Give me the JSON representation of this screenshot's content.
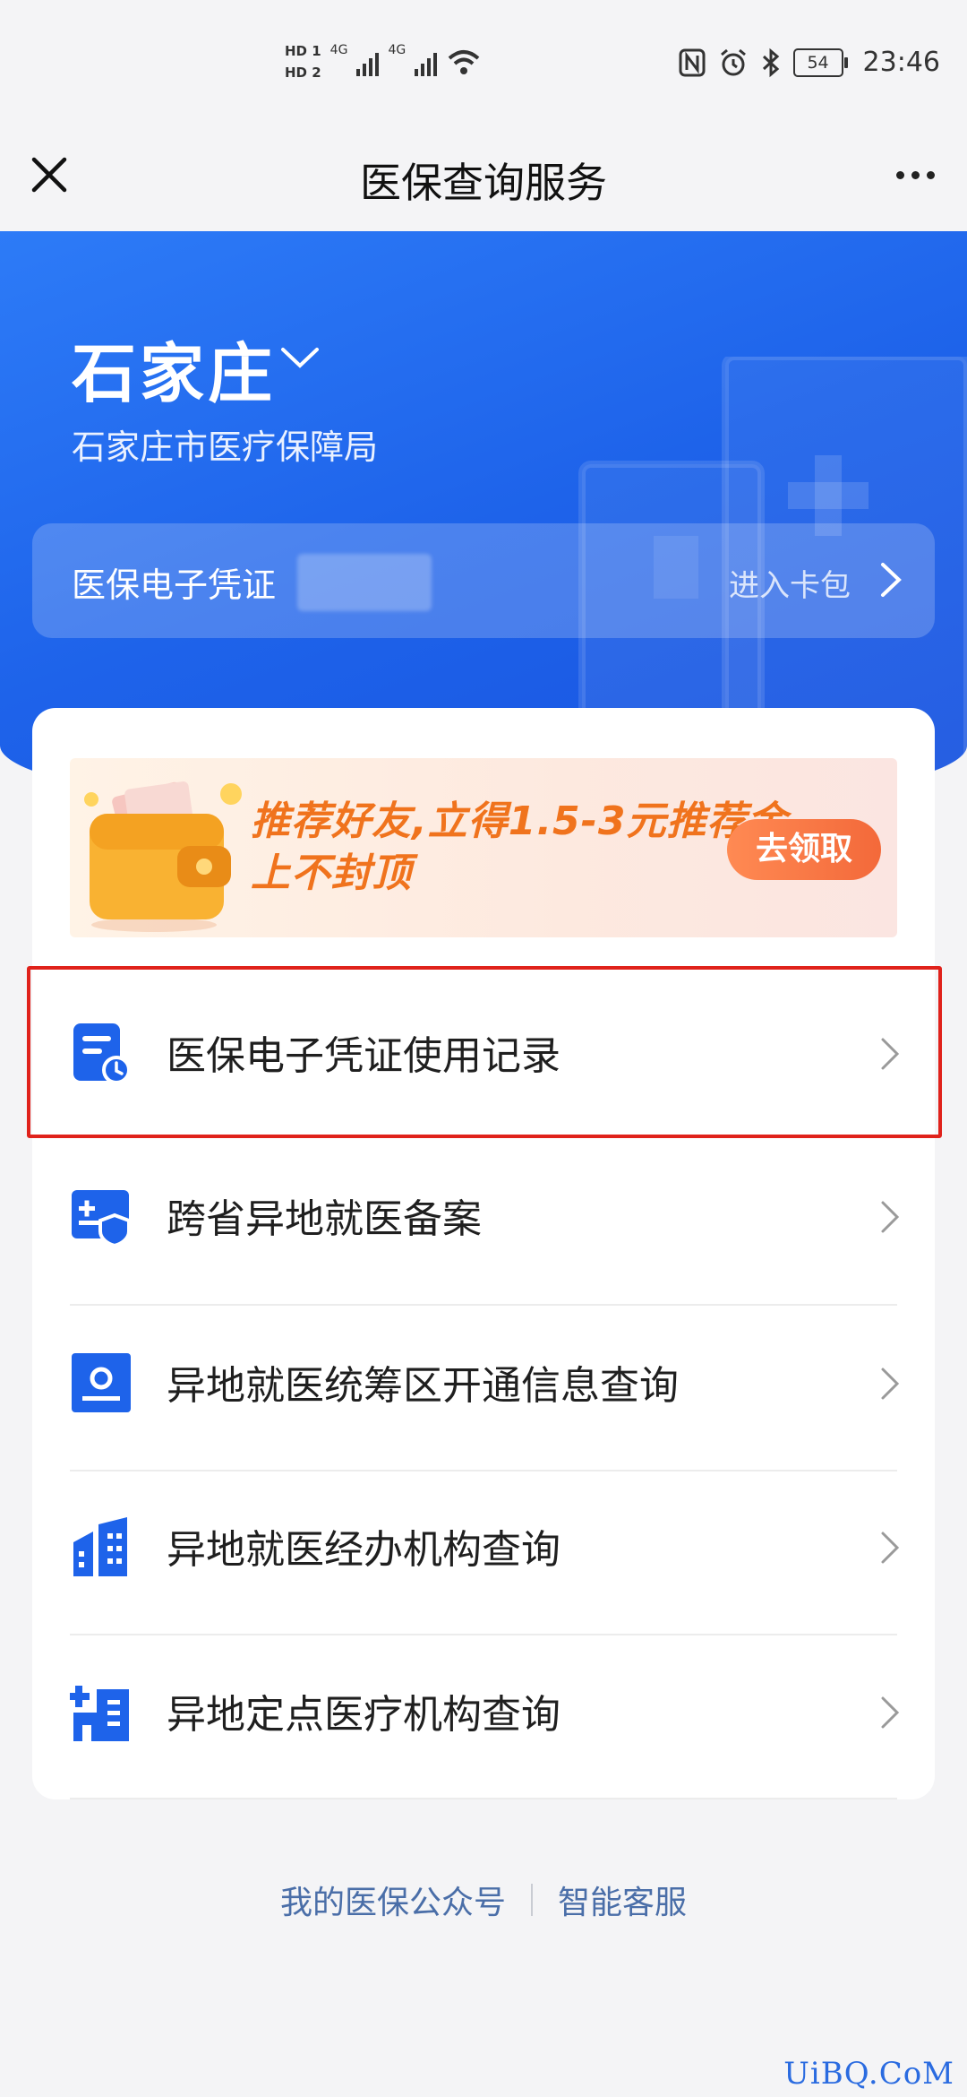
{
  "status_bar": {
    "hd1": "HD 1",
    "hd2": "HD 2",
    "net1": "4G",
    "net2": "4G",
    "battery": "54",
    "time": "23:46"
  },
  "titlebar": {
    "title": "医保查询服务"
  },
  "hero": {
    "city": "石家庄",
    "bureau": "石家庄市医疗保障局",
    "ecard_label": "医保电子凭证",
    "ecard_enter": "进入卡包"
  },
  "banner": {
    "line1": "推荐好友,立得1.5-3元推荐金",
    "line2": "上不封顶",
    "button": "去领取"
  },
  "menu": [
    {
      "label": "医保电子凭证使用记录",
      "icon": "record-doc-icon"
    },
    {
      "label": "跨省异地就医备案",
      "icon": "medical-shield-icon"
    },
    {
      "label": "异地就医统筹区开通信息查询",
      "icon": "user-card-icon"
    },
    {
      "label": "异地就医经办机构查询",
      "icon": "buildings-icon"
    },
    {
      "label": "异地定点医疗机构查询",
      "icon": "hospital-icon"
    }
  ],
  "footer": {
    "link1": "我的医保公众号",
    "link2": "智能客服"
  },
  "watermark": "UiBQ.CoM",
  "colors": {
    "primary": "#1e63ea",
    "highlight": "#e0221b",
    "banner_accent": "#f0731d"
  }
}
